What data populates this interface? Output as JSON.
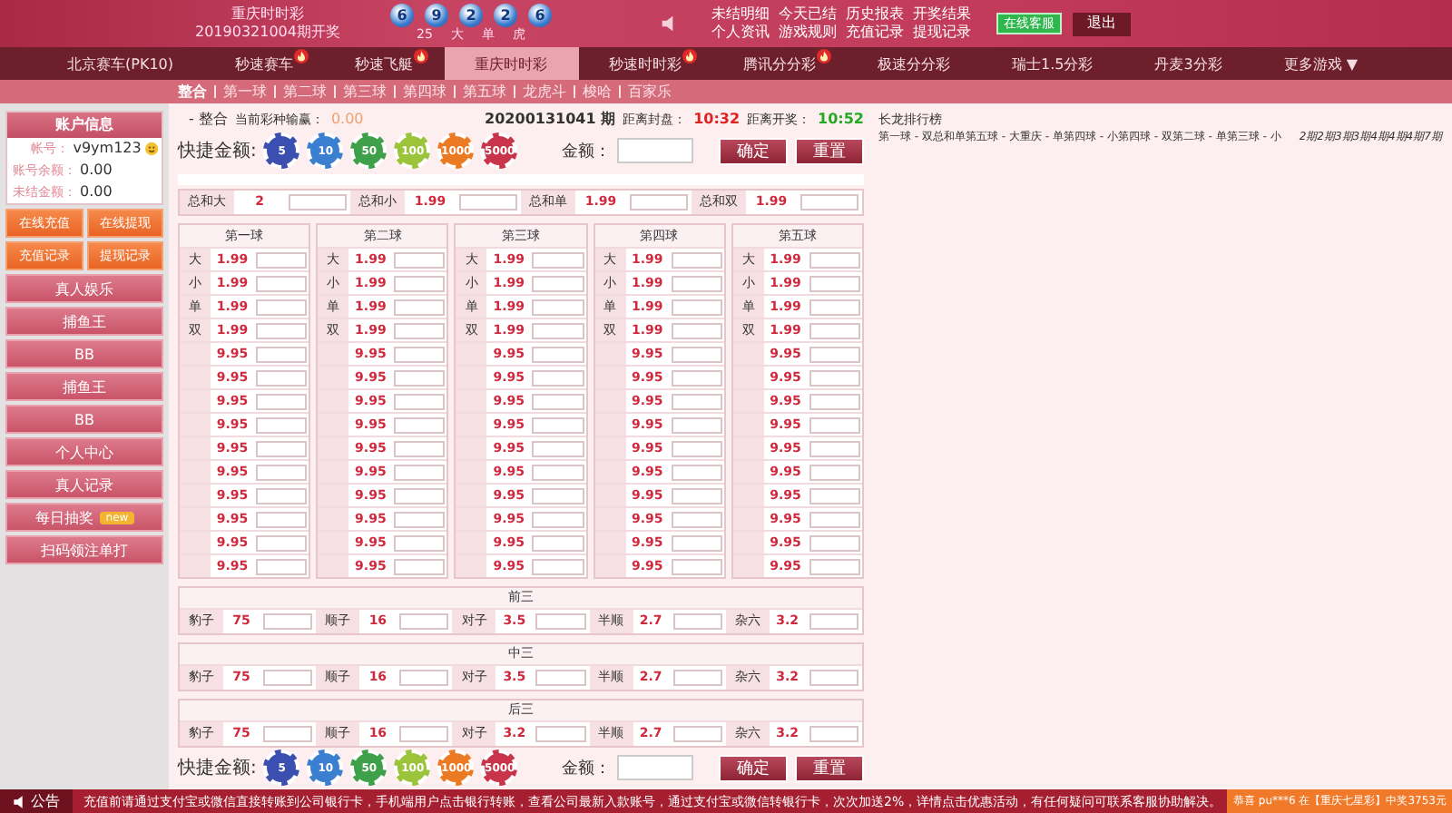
{
  "header": {
    "lottery_name": "重庆时时彩",
    "draw_label": "20190321004期开奖",
    "balls": [
      "6",
      "9",
      "2",
      "2",
      "6"
    ],
    "draw_tags": [
      "25",
      "大",
      "单",
      "虎"
    ],
    "links": [
      "未结明细",
      "今天已结",
      "历史报表",
      "开奖结果",
      "个人资讯",
      "游戏规则",
      "充值记录",
      "提现记录"
    ],
    "service_button": "在线客服",
    "logout_button": "退出"
  },
  "nav": [
    {
      "label": "北京赛车(PK10)",
      "hot": false,
      "selected": false
    },
    {
      "label": "秒速赛车",
      "hot": true,
      "selected": false
    },
    {
      "label": "秒速飞艇",
      "hot": true,
      "selected": false
    },
    {
      "label": "重庆时时彩",
      "hot": false,
      "selected": true
    },
    {
      "label": "秒速时时彩",
      "hot": true,
      "selected": false
    },
    {
      "label": "腾讯分分彩",
      "hot": true,
      "selected": false
    },
    {
      "label": "极速分分彩",
      "hot": false,
      "selected": false
    },
    {
      "label": "瑞士1.5分彩",
      "hot": false,
      "selected": false
    },
    {
      "label": "丹麦3分彩",
      "hot": false,
      "selected": false
    },
    {
      "label": "更多游戏 ▼",
      "hot": false,
      "selected": false
    }
  ],
  "subnav": [
    {
      "label": "整合",
      "selected": true
    },
    {
      "label": "第一球",
      "selected": false
    },
    {
      "label": "第二球",
      "selected": false
    },
    {
      "label": "第三球",
      "selected": false
    },
    {
      "label": "第四球",
      "selected": false
    },
    {
      "label": "第五球",
      "selected": false
    },
    {
      "label": "龙虎斗",
      "selected": false
    },
    {
      "label": "梭哈",
      "selected": false
    },
    {
      "label": "百家乐",
      "selected": false
    }
  ],
  "sidebar": {
    "title": "账户信息",
    "account": [
      {
        "label": "帐号：",
        "value": "v9ym123"
      },
      {
        "label": "账号余额：",
        "value": "0.00"
      },
      {
        "label": "未结金额：",
        "value": "0.00"
      }
    ],
    "action_buttons": [
      "在线充值",
      "在线提现",
      "充值记录",
      "提现记录"
    ],
    "menu": [
      {
        "label": "真人娱乐"
      },
      {
        "label": "捕鱼王"
      },
      {
        "label": "BB"
      },
      {
        "label": "捕鱼王"
      },
      {
        "label": "BB"
      },
      {
        "label": "个人中心"
      },
      {
        "label": "真人记录"
      },
      {
        "label": "每日抽奖",
        "badge": "new"
      },
      {
        "label": "扫码领注单打"
      }
    ]
  },
  "summary": {
    "mode": "- 整合",
    "profit_label": "当前彩种输赢：",
    "profit": "0.00",
    "period": "20200131041 期",
    "close_label": "距离封盘：",
    "close_time": "10:32",
    "open_label": "距离开奖：",
    "open_time": "10:52"
  },
  "quick": {
    "label": "快捷金额:",
    "chips": [
      {
        "label": "5",
        "color": "#3b4fb0"
      },
      {
        "label": "10",
        "color": "#3a7fd0"
      },
      {
        "label": "50",
        "color": "#3fa04a"
      },
      {
        "label": "100",
        "color": "#9cc43a"
      },
      {
        "label": "1000",
        "color": "#ec7a22"
      },
      {
        "label": "5000",
        "color": "#c8344a"
      }
    ],
    "amount_label": "金额：",
    "confirm": "确定",
    "reset": "重置"
  },
  "totals": [
    {
      "label": "总和大",
      "odds": "2"
    },
    {
      "label": "总和小",
      "odds": "1.99"
    },
    {
      "label": "总和单",
      "odds": "1.99"
    },
    {
      "label": "总和双",
      "odds": "1.99"
    }
  ],
  "balls": [
    {
      "title": "第一球",
      "rows": [
        {
          "label": "大",
          "odds": "1.99"
        },
        {
          "label": "小",
          "odds": "1.99"
        },
        {
          "label": "单",
          "odds": "1.99"
        },
        {
          "label": "双",
          "odds": "1.99"
        },
        {
          "odds": "9.95"
        },
        {
          "odds": "9.95"
        },
        {
          "odds": "9.95"
        },
        {
          "odds": "9.95"
        },
        {
          "odds": "9.95"
        },
        {
          "odds": "9.95"
        },
        {
          "odds": "9.95"
        },
        {
          "odds": "9.95"
        },
        {
          "odds": "9.95"
        },
        {
          "odds": "9.95"
        }
      ]
    },
    {
      "title": "第二球",
      "rows": [
        {
          "label": "大",
          "odds": "1.99"
        },
        {
          "label": "小",
          "odds": "1.99"
        },
        {
          "label": "单",
          "odds": "1.99"
        },
        {
          "label": "双",
          "odds": "1.99"
        },
        {
          "odds": "9.95"
        },
        {
          "odds": "9.95"
        },
        {
          "odds": "9.95"
        },
        {
          "odds": "9.95"
        },
        {
          "odds": "9.95"
        },
        {
          "odds": "9.95"
        },
        {
          "odds": "9.95"
        },
        {
          "odds": "9.95"
        },
        {
          "odds": "9.95"
        },
        {
          "odds": "9.95"
        }
      ]
    },
    {
      "title": "第三球",
      "rows": [
        {
          "label": "大",
          "odds": "1.99"
        },
        {
          "label": "小",
          "odds": "1.99"
        },
        {
          "label": "单",
          "odds": "1.99"
        },
        {
          "label": "双",
          "odds": "1.99"
        },
        {
          "odds": "9.95"
        },
        {
          "odds": "9.95"
        },
        {
          "odds": "9.95"
        },
        {
          "odds": "9.95"
        },
        {
          "odds": "9.95"
        },
        {
          "odds": "9.95"
        },
        {
          "odds": "9.95"
        },
        {
          "odds": "9.95"
        },
        {
          "odds": "9.95"
        },
        {
          "odds": "9.95"
        }
      ]
    },
    {
      "title": "第四球",
      "rows": [
        {
          "label": "大",
          "odds": "1.99"
        },
        {
          "label": "小",
          "odds": "1.99"
        },
        {
          "label": "单",
          "odds": "1.99"
        },
        {
          "label": "双",
          "odds": "1.99"
        },
        {
          "odds": "9.95"
        },
        {
          "odds": "9.95"
        },
        {
          "odds": "9.95"
        },
        {
          "odds": "9.95"
        },
        {
          "odds": "9.95"
        },
        {
          "odds": "9.95"
        },
        {
          "odds": "9.95"
        },
        {
          "odds": "9.95"
        },
        {
          "odds": "9.95"
        },
        {
          "odds": "9.95"
        }
      ]
    },
    {
      "title": "第五球",
      "rows": [
        {
          "label": "大",
          "odds": "1.99"
        },
        {
          "label": "小",
          "odds": "1.99"
        },
        {
          "label": "单",
          "odds": "1.99"
        },
        {
          "label": "双",
          "odds": "1.99"
        },
        {
          "odds": "9.95"
        },
        {
          "odds": "9.95"
        },
        {
          "odds": "9.95"
        },
        {
          "odds": "9.95"
        },
        {
          "odds": "9.95"
        },
        {
          "odds": "9.95"
        },
        {
          "odds": "9.95"
        },
        {
          "odds": "9.95"
        },
        {
          "odds": "9.95"
        },
        {
          "odds": "9.95"
        }
      ]
    }
  ],
  "combos": [
    {
      "title": "前三",
      "items": [
        {
          "label": "豹子",
          "odds": "75"
        },
        {
          "label": "顺子",
          "odds": "16"
        },
        {
          "label": "对子",
          "odds": "3.5"
        },
        {
          "label": "半顺",
          "odds": "2.7"
        },
        {
          "label": "杂六",
          "odds": "3.2"
        }
      ]
    },
    {
      "title": "中三",
      "items": [
        {
          "label": "豹子",
          "odds": "75"
        },
        {
          "label": "顺子",
          "odds": "16"
        },
        {
          "label": "对子",
          "odds": "3.5"
        },
        {
          "label": "半顺",
          "odds": "2.7"
        },
        {
          "label": "杂六",
          "odds": "3.2"
        }
      ]
    },
    {
      "title": "后三",
      "items": [
        {
          "label": "豹子",
          "odds": "75"
        },
        {
          "label": "顺子",
          "odds": "16"
        },
        {
          "label": "对子",
          "odds": "3.2"
        },
        {
          "label": "半顺",
          "odds": "2.7"
        },
        {
          "label": "杂六",
          "odds": "3.2"
        }
      ]
    }
  ],
  "bottom_quick": {
    "label": "快捷金额:",
    "chips": [
      {
        "label": "5",
        "color": "#3b4fb0"
      },
      {
        "label": "10",
        "color": "#3a7fd0"
      },
      {
        "label": "50",
        "color": "#3fa04a"
      },
      {
        "label": "100",
        "color": "#9cc43a"
      },
      {
        "label": "1000",
        "color": "#ec7a22"
      },
      {
        "label": "5000",
        "color": "#c8344a"
      }
    ],
    "amount_label": "金额：",
    "confirm": "确定",
    "reset": "重置"
  },
  "dragon": {
    "title": "长龙排行榜",
    "text": "第一球 - 双总和单第五球 - 大重庆 - 单第四球 - 小第四球 - 双第二球 - 单第三球 - 小",
    "streaks": "2期2期3期3期4期4期4期7期"
  },
  "footer": {
    "notice_label": "公告",
    "text": "充值前请通过支付宝或微信直接转账到公司银行卡，手机端用户点击银行转账，查看公司最新入款账号，通过支付宝或微信转银行卡，次次加送2%，详情点击优惠活动，有任何疑问可联系客服协助解决。",
    "winner": "恭喜 pu***6 在【重庆七星彩】中奖3753元"
  }
}
